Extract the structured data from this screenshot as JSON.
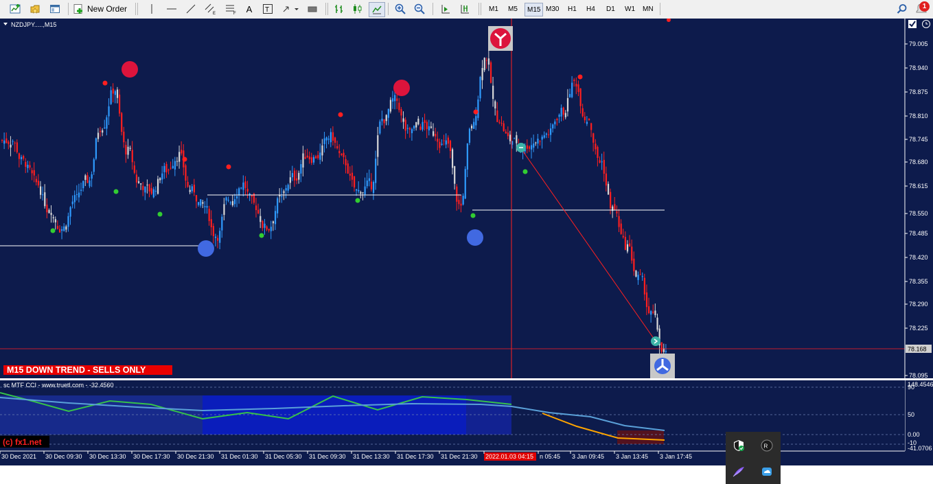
{
  "toolbar": {
    "new_order_label": "New Order",
    "timeframes": [
      "M1",
      "M5",
      "M15",
      "M30",
      "H1",
      "H4",
      "D1",
      "W1",
      "MN"
    ],
    "active_timeframe": "M15",
    "notification_count": "1"
  },
  "chart": {
    "symbol_label": "NZDJPY.....,M15",
    "trend_banner": "M15  DOWN TREND - SELLS ONLY",
    "copyright": "(c) fx1.net",
    "current_price_label": "78.168",
    "price_ticks": [
      "79.005",
      "78.940",
      "78.875",
      "78.810",
      "78.745",
      "78.680",
      "78.615",
      "78.550",
      "78.485",
      "78.420",
      "78.355",
      "78.290",
      "78.225",
      "78.095"
    ],
    "time_ticks": [
      "30 Dec 2021",
      "30 Dec 09:30",
      "30 Dec 13:30",
      "30 Dec 17:30",
      "30 Dec 21:30",
      "31 Dec 01:30",
      "31 Dec 05:30",
      "31 Dec 09:30",
      "31 Dec 13:30",
      "31 Dec 17:30",
      "31 Dec 21:30",
      "2022.01.03 04:15",
      "n 05:45",
      "3 Jan 09:45",
      "3 Jan 13:45",
      "3 Jan 17:45"
    ],
    "colors": {
      "background": "#0d1b4c",
      "bull": "#2f9bff",
      "bear": "#ff1f1f",
      "neutral": "#d8d8d8",
      "crosshair": "#ff2020"
    }
  },
  "indicator": {
    "label": "sc MTF CCI - www.truetl.com - -32.4560",
    "level_ticks": [
      "148.4546",
      "90",
      "50",
      "0.00",
      "-10",
      "-41.0706"
    ]
  },
  "tray": {
    "icons": [
      "shield-check-icon",
      "media-icon",
      "feather-icon",
      "cloud-icon"
    ]
  },
  "chart_data": {
    "type": "candlestick",
    "symbol": "NZDJPY",
    "timeframe": "M15",
    "ylim": [
      78.095,
      79.005
    ],
    "series": [
      {
        "name": "close",
        "values": [
          78.74,
          78.68,
          78.62,
          78.55,
          78.5,
          78.58,
          78.63,
          78.78,
          78.88,
          78.71,
          78.62,
          78.6,
          78.66,
          78.7,
          78.6,
          78.56,
          78.48,
          78.58,
          78.62,
          78.56,
          78.5,
          78.58,
          78.64,
          78.7,
          78.7,
          78.75,
          78.68,
          78.6,
          78.62,
          78.8,
          78.85,
          78.76,
          78.78,
          78.76,
          78.73,
          78.56,
          78.78,
          78.97,
          78.8,
          78.74,
          78.72,
          78.74,
          78.76,
          78.82,
          78.9,
          78.8,
          78.68,
          78.55,
          78.45,
          78.36,
          78.26,
          78.15
        ]
      }
    ],
    "levels": [
      78.468,
      78.592,
      78.55
    ],
    "current_price": 78.168
  }
}
